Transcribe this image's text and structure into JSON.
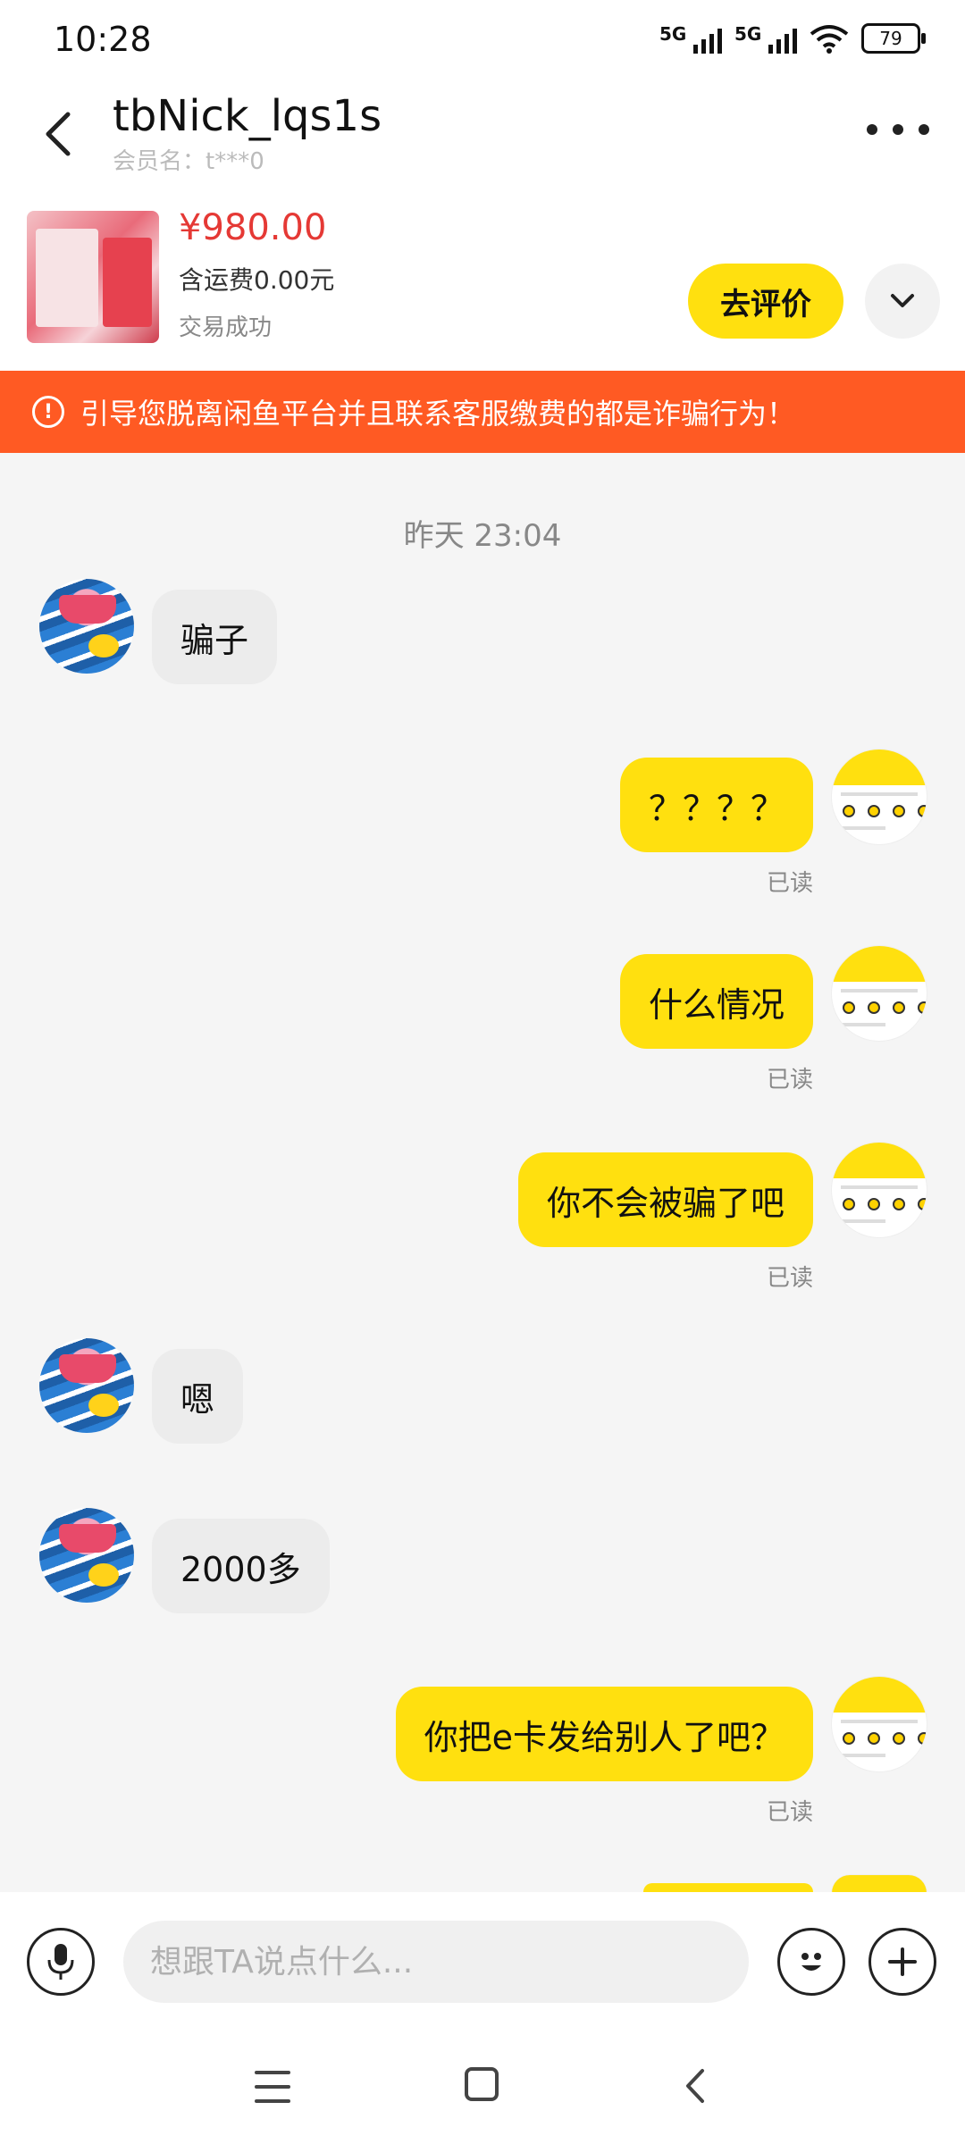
{
  "status_bar": {
    "time": "10:28",
    "signal1": "5G",
    "signal2": "5G",
    "battery": "79"
  },
  "header": {
    "title": "tbNick_lqs1s",
    "subtitle": "会员名：t***0"
  },
  "product": {
    "price": "¥980.00",
    "shipping": "含运费0.00元",
    "status": "交易成功",
    "review_button": "去评价"
  },
  "warning": {
    "text": "引导您脱离闲鱼平台并且联系客服缴费的都是诈骗行为！",
    "icon_glyph": "!"
  },
  "chat": {
    "timestamp": "昨天 23:04",
    "messages": [
      {
        "sender": "other",
        "text": "骗子"
      },
      {
        "sender": "me",
        "text": "？？？？",
        "read": "已读"
      },
      {
        "sender": "me",
        "text": "什么情况",
        "read": "已读"
      },
      {
        "sender": "me",
        "text": "你不会被骗了吧",
        "read": "已读"
      },
      {
        "sender": "other",
        "text": "嗯"
      },
      {
        "sender": "other",
        "text": "2000多"
      },
      {
        "sender": "me",
        "text": "你把e卡发给别人了吧？",
        "read": "已读"
      }
    ]
  },
  "input": {
    "placeholder": "想跟TA说点什么..."
  },
  "colors": {
    "accent_yellow": "#ffe00f",
    "warning_orange": "#ff5a23",
    "price_red": "#e53935"
  },
  "icons": [
    "back-arrow-icon",
    "more-icon",
    "chevron-down-icon",
    "warning-icon",
    "microphone-icon",
    "emoji-icon",
    "plus-icon",
    "menu-icon",
    "home-icon",
    "nav-back-icon"
  ]
}
